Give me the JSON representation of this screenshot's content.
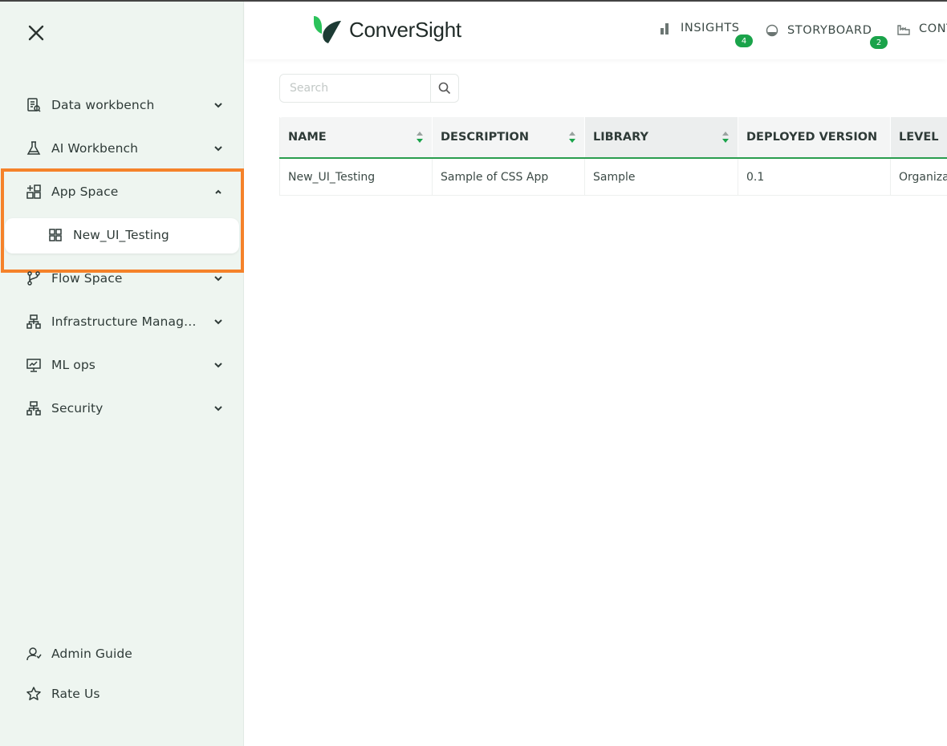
{
  "sidebar": {
    "items": [
      {
        "label": "Data workbench",
        "icon": "data-workbench-icon"
      },
      {
        "label": "AI Workbench",
        "icon": "flask-icon"
      },
      {
        "label": "App Space",
        "icon": "app-space-icon",
        "expanded": true
      },
      {
        "label": "Flow Space",
        "icon": "flow-branch-icon"
      },
      {
        "label": "Infrastructure Management",
        "icon": "infrastructure-icon"
      },
      {
        "label": "ML ops",
        "icon": "ml-ops-icon"
      },
      {
        "label": "Security",
        "icon": "security-icon"
      }
    ],
    "sub_items": [
      {
        "label": "New_UI_Testing",
        "icon": "grid-icon"
      }
    ],
    "footer": [
      {
        "label": "Admin Guide",
        "icon": "admin-guide-icon"
      },
      {
        "label": "Rate Us",
        "icon": "star-icon"
      }
    ]
  },
  "header": {
    "logo_text": "ConverSight",
    "nav": [
      {
        "label": "INSIGHTS",
        "badge": "4",
        "icon": "bar-chart-icon"
      },
      {
        "label": "STORYBOARD",
        "badge": "2",
        "icon": "storyboard-icon"
      },
      {
        "label": "CONT",
        "icon": "factory-icon"
      }
    ]
  },
  "search": {
    "placeholder": "Search",
    "value": ""
  },
  "table": {
    "columns": [
      "NAME",
      "DESCRIPTION",
      "LIBRARY",
      "DEPLOYED VERSION",
      "LEVEL"
    ],
    "rows": [
      [
        "New_UI_Testing",
        "Sample of CSS App",
        "Sample",
        "0.1",
        "Organiza"
      ]
    ]
  },
  "colors": {
    "accent": "#1aa34a",
    "highlight": "#f5822a",
    "sidebar_bg": "#eef5f0"
  }
}
